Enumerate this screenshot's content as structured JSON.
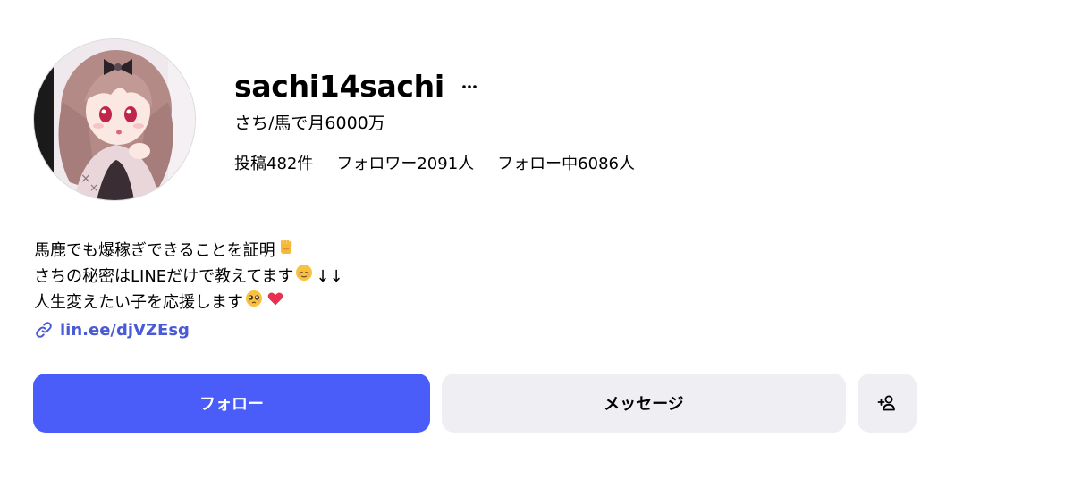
{
  "profile": {
    "username": "sachi14sachi",
    "more_label": "···",
    "full_name": "さち/馬で月6000万",
    "stats": {
      "posts": "投稿482件",
      "followers": "フォロワー2091人",
      "following": "フォロー中6086人"
    },
    "bio": [
      "馬鹿でも爆稼ぎできることを証明",
      "さちの秘密はLINEだけで教えてます",
      "人生変えたい子を応援します"
    ],
    "bio_tail": "↓↓",
    "link": "lin.ee/djVZEsg"
  },
  "actions": {
    "follow": "フォロー",
    "message": "メッセージ"
  },
  "icons": {
    "more": "more-horizontal-icon",
    "link": "link-icon",
    "add_user": "add-user-icon",
    "emoji_1": "raised-fist-emoji-icon",
    "emoji_2": "relieved-face-emoji-icon",
    "emoji_3": "pleading-face-emoji-icon",
    "emoji_4": "red-heart-emoji-icon"
  },
  "colors": {
    "accent": "#4a5df9",
    "link": "#4a5ad6",
    "secondary_button": "#efeff3"
  }
}
